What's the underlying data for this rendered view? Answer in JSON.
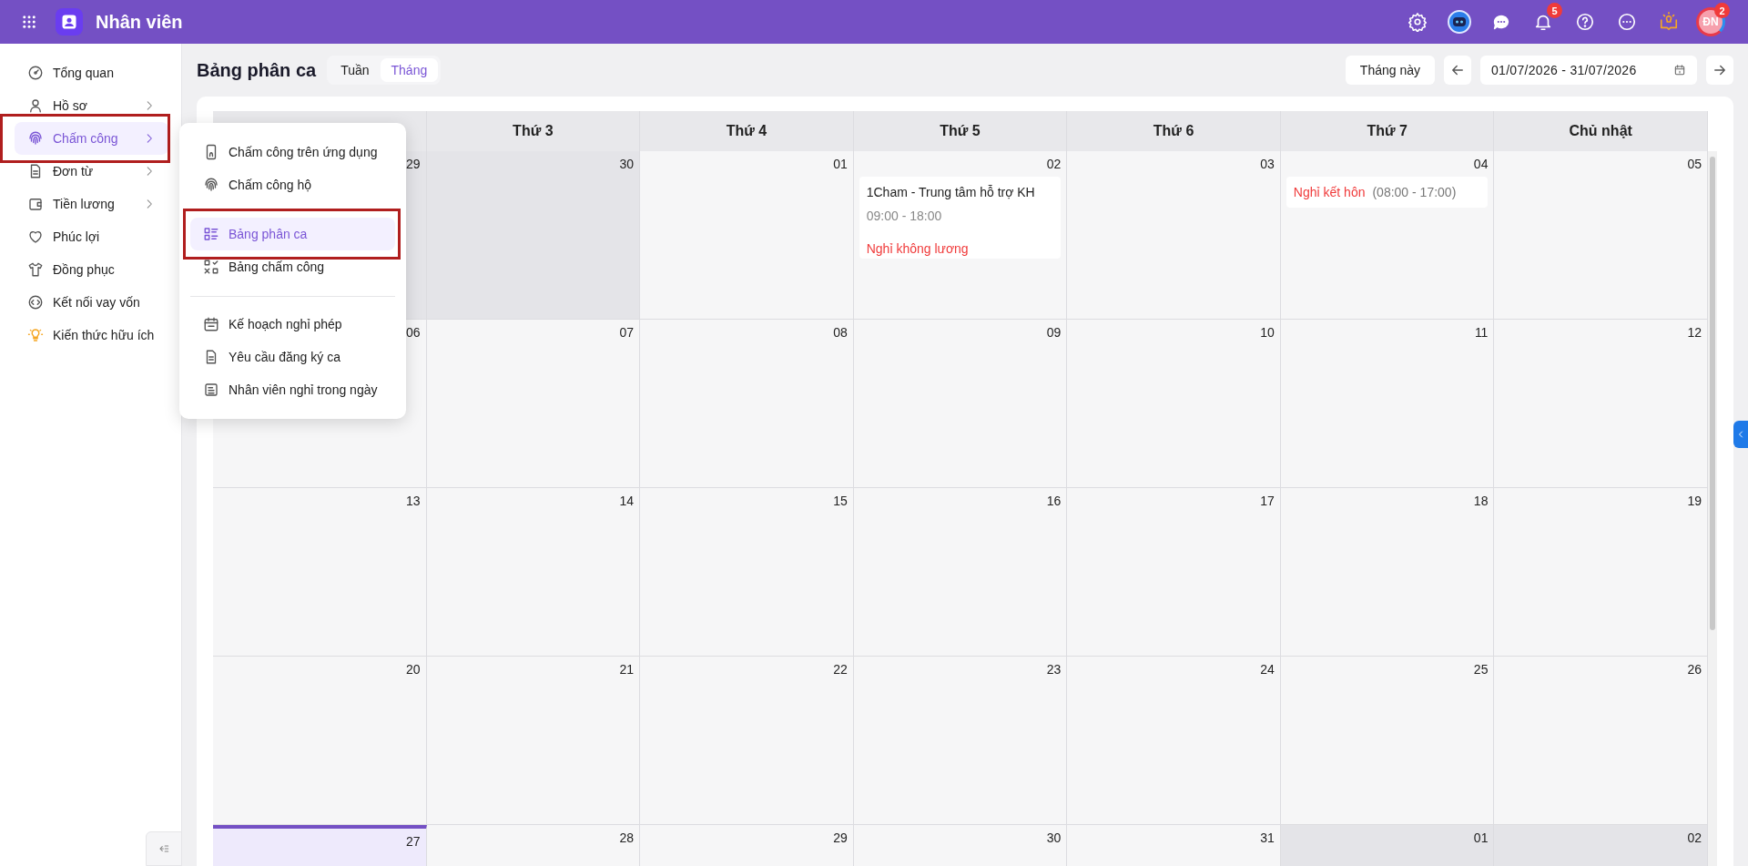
{
  "app": {
    "title": "Nhân viên"
  },
  "header_icons": [
    {
      "kind": "settings"
    },
    {
      "kind": "bot"
    },
    {
      "kind": "chat"
    },
    {
      "kind": "bell",
      "badge": "5"
    },
    {
      "kind": "help"
    },
    {
      "kind": "more"
    },
    {
      "kind": "idea"
    },
    {
      "kind": "avatar",
      "initials": "ĐN",
      "badge": "2"
    }
  ],
  "sidebar": {
    "items": [
      {
        "label": "Tổng quan",
        "kind": "dashboard",
        "has_submenu": false,
        "selected": false,
        "annotated": false
      },
      {
        "label": "Hồ sơ",
        "kind": "user",
        "has_submenu": true,
        "selected": false,
        "annotated": false
      },
      {
        "label": "Chấm công",
        "kind": "fingerprint",
        "has_submenu": true,
        "selected": true,
        "annotated": true
      },
      {
        "label": "Đơn từ",
        "kind": "document",
        "has_submenu": true,
        "selected": false,
        "annotated": false
      },
      {
        "label": "Tiền lương",
        "kind": "wallet",
        "has_submenu": true,
        "selected": false,
        "annotated": false
      },
      {
        "label": "Phúc lợi",
        "kind": "heart",
        "has_submenu": false,
        "selected": false,
        "annotated": false
      },
      {
        "label": "Đồng phục",
        "kind": "shirt",
        "has_submenu": false,
        "selected": false,
        "annotated": false
      },
      {
        "label": "Kết nối vay vốn",
        "kind": "link",
        "has_submenu": false,
        "selected": false,
        "annotated": false
      },
      {
        "label": "Kiến thức hữu ích",
        "kind": "bulb",
        "has_submenu": false,
        "selected": false,
        "annotated": false
      }
    ]
  },
  "submenu": {
    "groups": [
      [
        {
          "label": "Chấm công trên ứng dụng",
          "kind": "phone",
          "selected": false,
          "annotated": false
        },
        {
          "label": "Chấm công hộ",
          "kind": "fingerprint",
          "selected": false,
          "annotated": false
        }
      ],
      [
        {
          "label": "Bảng phân ca",
          "kind": "grid",
          "selected": true,
          "annotated": true
        },
        {
          "label": "Bảng chấm công",
          "kind": "check-grid",
          "selected": false,
          "annotated": false
        }
      ],
      [
        {
          "label": "Kế hoạch nghỉ phép",
          "kind": "calendar",
          "selected": false,
          "annotated": false
        },
        {
          "label": "Yêu cầu đăng ký ca",
          "kind": "document",
          "selected": false,
          "annotated": false
        },
        {
          "label": "Nhân viên nghỉ trong ngày",
          "kind": "list",
          "selected": false,
          "annotated": false
        }
      ]
    ]
  },
  "page": {
    "title": "Bảng phân ca",
    "view_tabs": [
      {
        "label": "Tuần",
        "selected": false
      },
      {
        "label": "Tháng",
        "selected": true
      }
    ],
    "today_button": "Tháng này",
    "date_range": "01/07/2026 - 31/07/2026"
  },
  "calendar": {
    "columns": [
      "Thứ 3",
      "Thứ 4",
      "Thứ 5",
      "Thứ 6",
      "Thứ 7",
      "Chủ nhật"
    ],
    "weeks": [
      [
        {
          "day": "29",
          "outside": true,
          "today": false
        },
        {
          "day": "30",
          "outside": true,
          "today": false
        },
        {
          "day": "01",
          "outside": false,
          "today": false
        },
        {
          "day": "02",
          "outside": false,
          "today": false,
          "cards": [
            [
              {
                "kind": "shift",
                "title": "1Cham - Trung tâm hỗ trợ KH",
                "time": "09:00 - 18:00"
              },
              {
                "kind": "leave",
                "label": "Nghỉ không lương"
              }
            ]
          ]
        },
        {
          "day": "03",
          "outside": false,
          "today": false
        },
        {
          "day": "04",
          "outside": false,
          "today": false,
          "cards": [
            [
              {
                "kind": "leave",
                "label": "Nghỉ kết hôn",
                "time": "(08:00 - 17:00)"
              }
            ]
          ]
        },
        {
          "day": "05",
          "outside": false,
          "today": false
        }
      ],
      [
        {
          "day": "06",
          "outside": false,
          "today": false
        },
        {
          "day": "07",
          "outside": false,
          "today": false
        },
        {
          "day": "08",
          "outside": false,
          "today": false
        },
        {
          "day": "09",
          "outside": false,
          "today": false
        },
        {
          "day": "10",
          "outside": false,
          "today": false
        },
        {
          "day": "11",
          "outside": false,
          "today": false
        },
        {
          "day": "12",
          "outside": false,
          "today": false
        }
      ],
      [
        {
          "day": "13",
          "outside": false,
          "today": false
        },
        {
          "day": "14",
          "outside": false,
          "today": false
        },
        {
          "day": "15",
          "outside": false,
          "today": false
        },
        {
          "day": "16",
          "outside": false,
          "today": false
        },
        {
          "day": "17",
          "outside": false,
          "today": false
        },
        {
          "day": "18",
          "outside": false,
          "today": false
        },
        {
          "day": "19",
          "outside": false,
          "today": false
        }
      ],
      [
        {
          "day": "20",
          "outside": false,
          "today": false
        },
        {
          "day": "21",
          "outside": false,
          "today": false
        },
        {
          "day": "22",
          "outside": false,
          "today": false
        },
        {
          "day": "23",
          "outside": false,
          "today": false
        },
        {
          "day": "24",
          "outside": false,
          "today": false
        },
        {
          "day": "25",
          "outside": false,
          "today": false
        },
        {
          "day": "26",
          "outside": false,
          "today": false
        }
      ],
      [
        {
          "day": "27",
          "outside": false,
          "today": true
        },
        {
          "day": "28",
          "outside": false,
          "today": false
        },
        {
          "day": "29",
          "outside": false,
          "today": false
        },
        {
          "day": "30",
          "outside": false,
          "today": false
        },
        {
          "day": "31",
          "outside": false,
          "today": false
        },
        {
          "day": "01",
          "outside": true,
          "today": false
        },
        {
          "day": "02",
          "outside": true,
          "today": false
        }
      ]
    ]
  }
}
